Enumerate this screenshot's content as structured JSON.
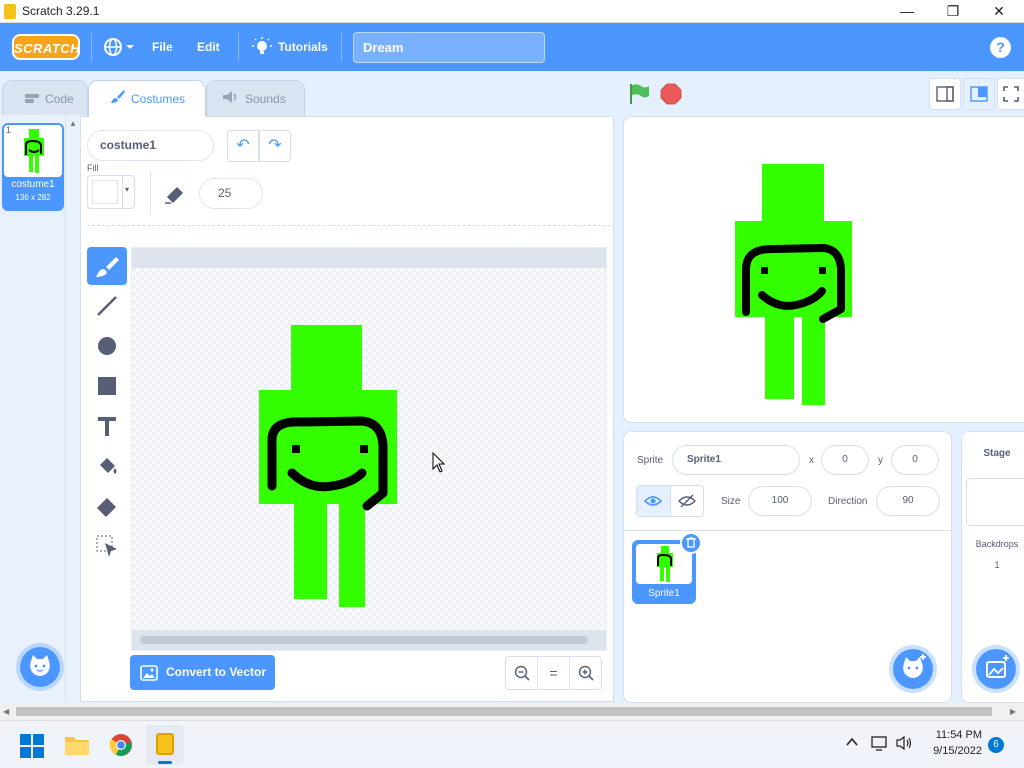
{
  "window": {
    "title": "Scratch 3.29.1",
    "minimize": "—",
    "maximize": "❐",
    "close": "✕"
  },
  "menubar": {
    "logo": "SCRATCH",
    "file": "File",
    "edit": "Edit",
    "tutorials": "Tutorials",
    "project_title": "Dream",
    "help": "?"
  },
  "tabs": {
    "code": "Code",
    "costumes": "Costumes",
    "sounds": "Sounds"
  },
  "costumes": [
    {
      "number": "1",
      "name": "costume1",
      "size": "136 x 282"
    }
  ],
  "paint": {
    "costume_name": "costume1",
    "fill_label": "Fill",
    "brush_size": "25",
    "convert_label": "Convert to Vector",
    "zoom_out": "−",
    "zoom_reset": "=",
    "zoom_in": "+",
    "undo": "↶",
    "redo": "↷"
  },
  "sprite": {
    "label": "Sprite",
    "name": "Sprite1",
    "x_label": "x",
    "x": "0",
    "y_label": "y",
    "y": "0",
    "show_label": "Show",
    "size_label": "Size",
    "size": "100",
    "direction_label": "Direction",
    "direction": "90",
    "card_name": "Sprite1"
  },
  "stage_panel": {
    "label": "Stage",
    "backdrops_label": "Backdrops",
    "backdrops_count": "1"
  },
  "taskbar": {
    "time": "11:54 PM",
    "date": "9/15/2022",
    "notifications": "6"
  },
  "colors": {
    "accent": "#4c97ff",
    "sprite_green": "#33ff00",
    "logo": "#f7a41b"
  }
}
